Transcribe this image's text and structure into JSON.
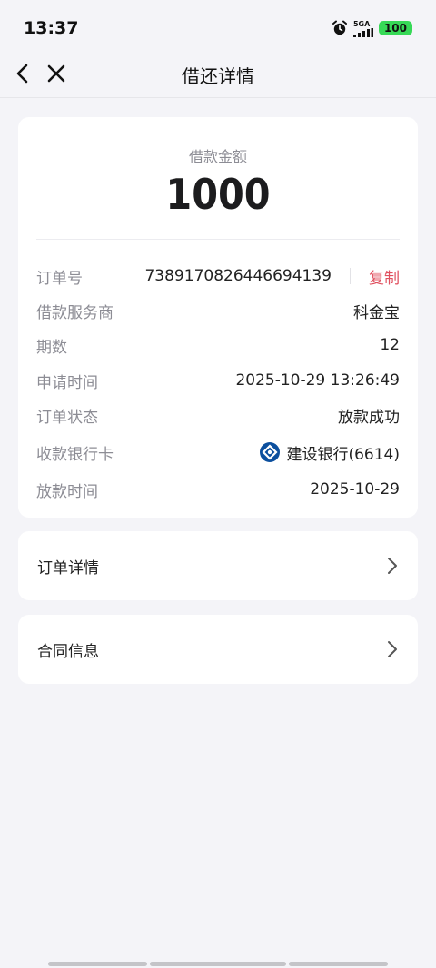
{
  "status_bar": {
    "time": "13:37",
    "network": "5GA",
    "battery": "100"
  },
  "nav": {
    "title": "借还详情"
  },
  "summary": {
    "amount_label": "借款金额",
    "amount": "1000"
  },
  "details": [
    {
      "label": "订单号",
      "value": "7389170826446694139"
    },
    {
      "label": "借款服务商",
      "value": "科金宝"
    },
    {
      "label": "期数",
      "value": "12"
    },
    {
      "label": "申请时间",
      "value": "2025-10-29 13:26:49"
    },
    {
      "label": "订单状态",
      "value": "放款成功"
    },
    {
      "label": "收款银行卡",
      "value": "建设银行(6614)"
    },
    {
      "label": "放款时间",
      "value": "2025-10-29"
    }
  ],
  "copy_label": "复制",
  "links": {
    "order_detail": "订单详情",
    "contract_info": "合同信息"
  },
  "colors": {
    "accent_red": "#e0505f",
    "battery_green": "#37d957",
    "bank_blue": "#0b4f9e"
  },
  "icons": {
    "back": "chevron-left-icon",
    "close": "close-icon",
    "link_arrow": "chevron-right-icon",
    "bank": "ccb-bank-logo-icon",
    "alarm": "alarm-icon",
    "signal": "signal-icon"
  }
}
